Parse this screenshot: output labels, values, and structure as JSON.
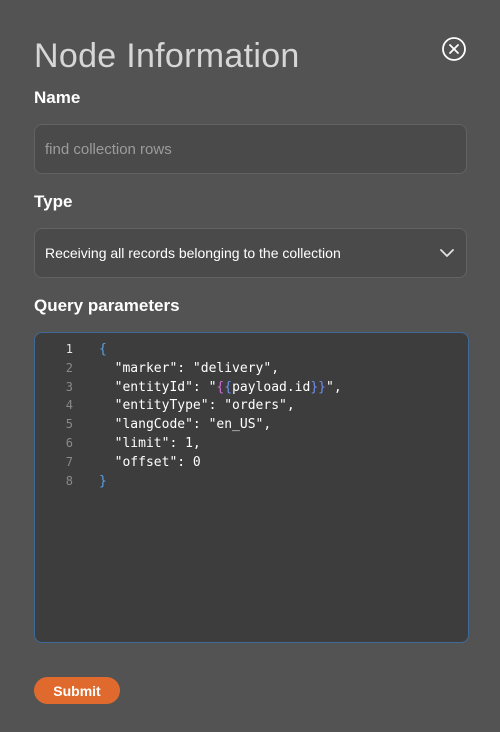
{
  "dialog": {
    "title": "Node Information",
    "close_icon": "close-circle-icon"
  },
  "name_field": {
    "label": "Name",
    "placeholder": "find collection rows",
    "value": ""
  },
  "type_field": {
    "label": "Type",
    "selected": "Receiving all records belonging to the collection",
    "chevron_icon": "chevron-down-icon"
  },
  "query": {
    "label": "Query parameters",
    "active_line": 1,
    "lines": [
      {
        "num": "1",
        "indent": "",
        "pre": "",
        "t1": "",
        "t2": "",
        "t3": "",
        "t4": "",
        "post": "",
        "brace": "{"
      },
      {
        "num": "2",
        "indent": "  ",
        "pre": "\"marker\": \"delivery\",",
        "t1": "",
        "t2": "",
        "t3": "",
        "t4": "",
        "post": "",
        "brace": ""
      },
      {
        "num": "3",
        "indent": "  ",
        "pre": "\"entityId\": \"",
        "t1": "{",
        "t2": "{",
        "t3": "payload.id",
        "t4": "}}",
        "post": "\",",
        "brace": ""
      },
      {
        "num": "4",
        "indent": "  ",
        "pre": "\"entityType\": \"orders\",",
        "t1": "",
        "t2": "",
        "t3": "",
        "t4": "",
        "post": "",
        "brace": ""
      },
      {
        "num": "5",
        "indent": "  ",
        "pre": "\"langCode\": \"en_US\",",
        "t1": "",
        "t2": "",
        "t3": "",
        "t4": "",
        "post": "",
        "brace": ""
      },
      {
        "num": "6",
        "indent": "  ",
        "pre": "\"limit\": 1,",
        "t1": "",
        "t2": "",
        "t3": "",
        "t4": "",
        "post": "",
        "brace": ""
      },
      {
        "num": "7",
        "indent": "  ",
        "pre": "\"offset\": 0",
        "t1": "",
        "t2": "",
        "t3": "",
        "t4": "",
        "post": "",
        "brace": ""
      },
      {
        "num": "8",
        "indent": "",
        "pre": "",
        "t1": "",
        "t2": "",
        "t3": "",
        "t4": "",
        "post": "",
        "brace": "}"
      }
    ]
  },
  "submit": {
    "label": "Submit"
  },
  "colors": {
    "background": "#545353",
    "field_bg": "#4a4a4a",
    "editor_bg": "#3d3d3d",
    "editor_border": "#3e6a99",
    "accent": "#e06a2d",
    "brace": "#5aa0e6",
    "template_brace_1": "#d26ad8",
    "template_brace_2": "#6f8ef0"
  }
}
